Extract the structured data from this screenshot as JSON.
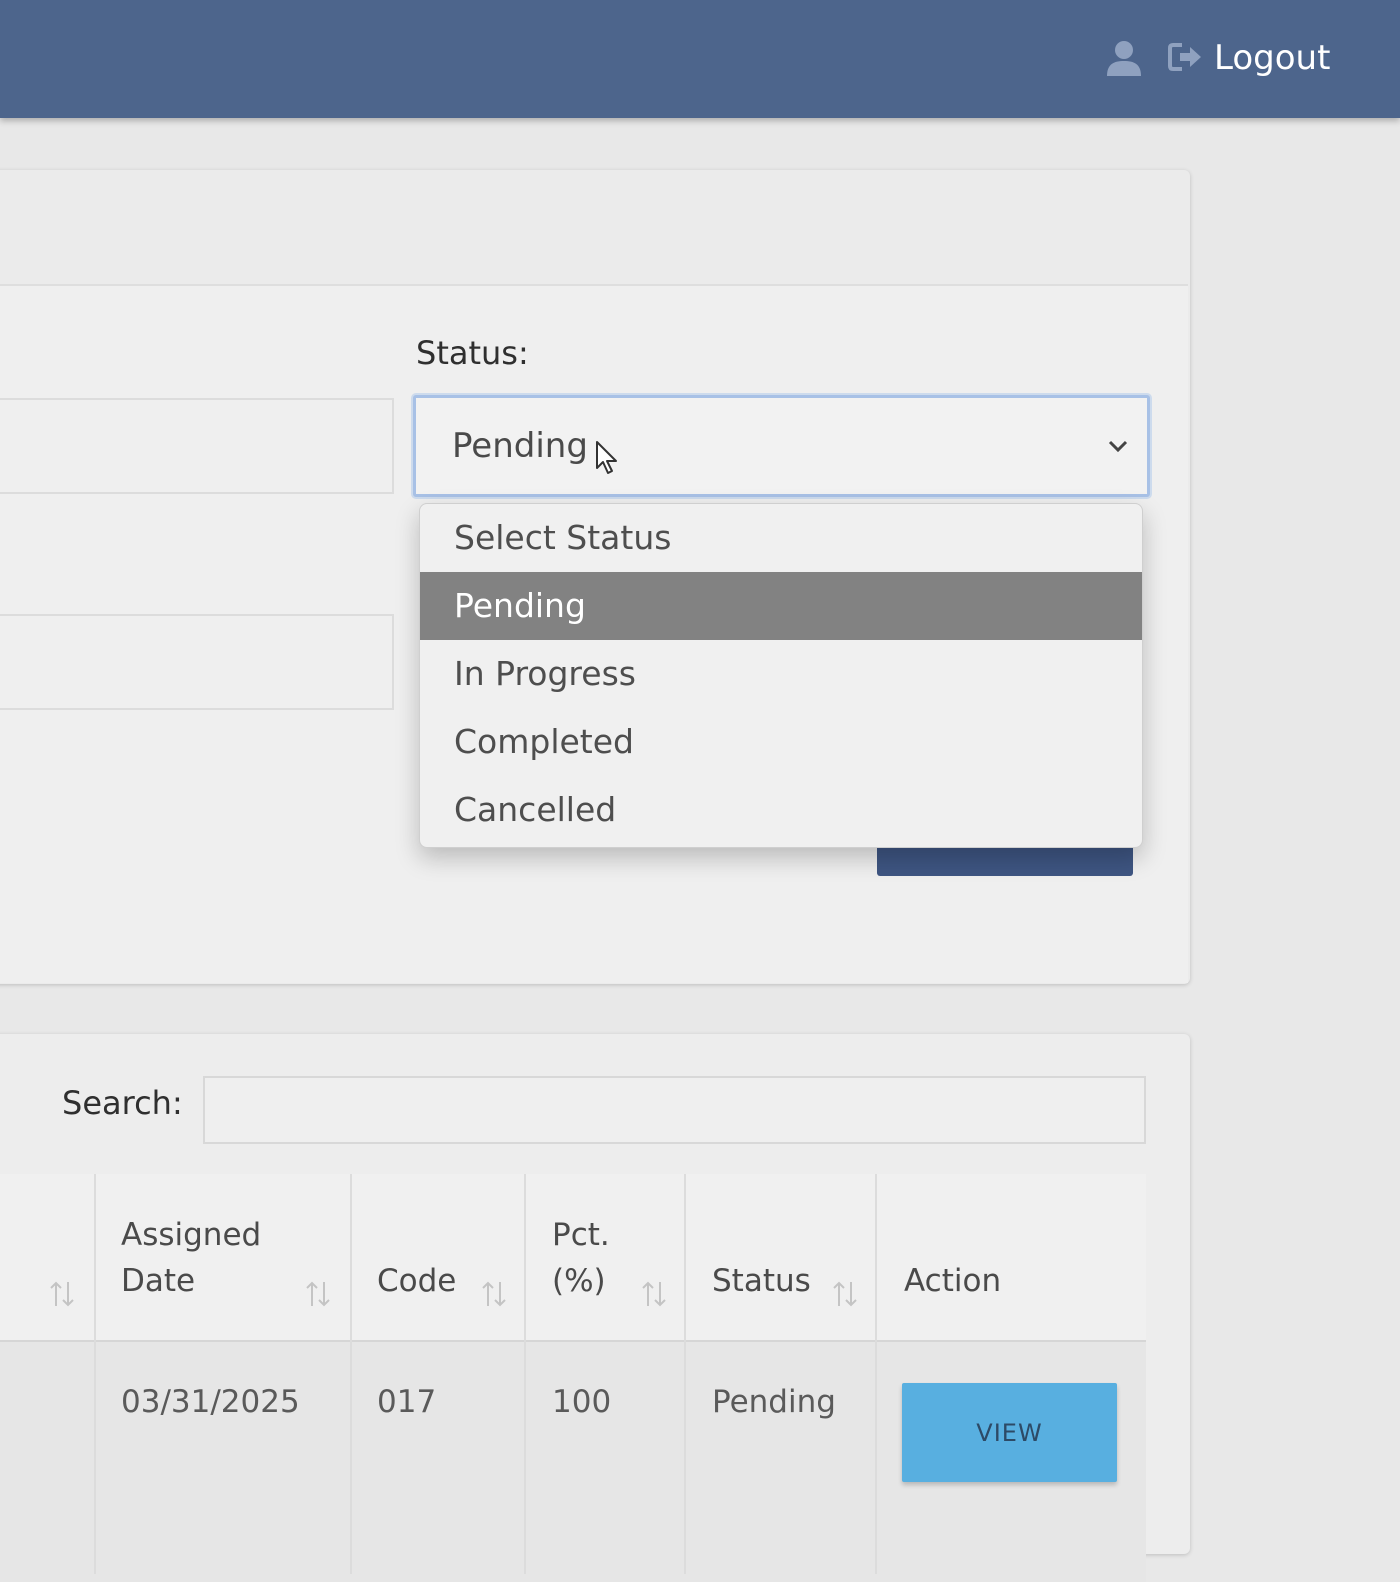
{
  "header": {
    "logout_label": "Logout"
  },
  "filter": {
    "status_label": "Status:",
    "status_value": "Pending",
    "status_options": [
      "Select Status",
      "Pending",
      "In Progress",
      "Completed",
      "Cancelled"
    ],
    "selected_index": 1
  },
  "table": {
    "search_label": "Search:",
    "columns": {
      "assigned_date_line1": "Assigned",
      "assigned_date_line2": "Date",
      "code": "Code",
      "pct_line1": "Pct.",
      "pct_line2": "(%)",
      "status": "Status",
      "action": "Action"
    },
    "row": {
      "assigned_date": "03/31/2025",
      "code": "017",
      "pct": "100",
      "status": "Pending",
      "action_label": "VIEW"
    }
  },
  "colors": {
    "topbar": "#4d658c",
    "selected_option": "#828282",
    "view_button": "#58afe0"
  }
}
